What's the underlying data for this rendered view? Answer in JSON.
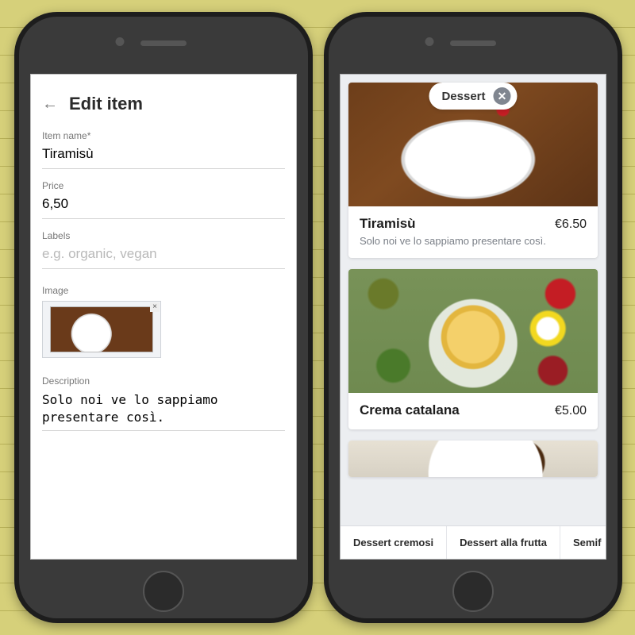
{
  "form": {
    "title": "Edit item",
    "fields": {
      "item_name": {
        "label": "Item name*",
        "value": "Tiramisù"
      },
      "price": {
        "label": "Price",
        "value": "6,50"
      },
      "labels": {
        "label": "Labels",
        "placeholder": "e.g. organic, vegan"
      },
      "image": {
        "label": "Image"
      },
      "description": {
        "label": "Description",
        "value": "Solo noi ve lo sappiamo presentare così."
      }
    }
  },
  "list": {
    "filter_chip": "Dessert",
    "items": [
      {
        "title": "Tiramisù",
        "price": "€6.50",
        "desc": "Solo noi ve lo sappiamo presentare così."
      },
      {
        "title": "Crema catalana",
        "price": "€5.00"
      }
    ],
    "tabs": [
      "Dessert cremosi",
      "Dessert alla frutta",
      "Semif"
    ]
  }
}
